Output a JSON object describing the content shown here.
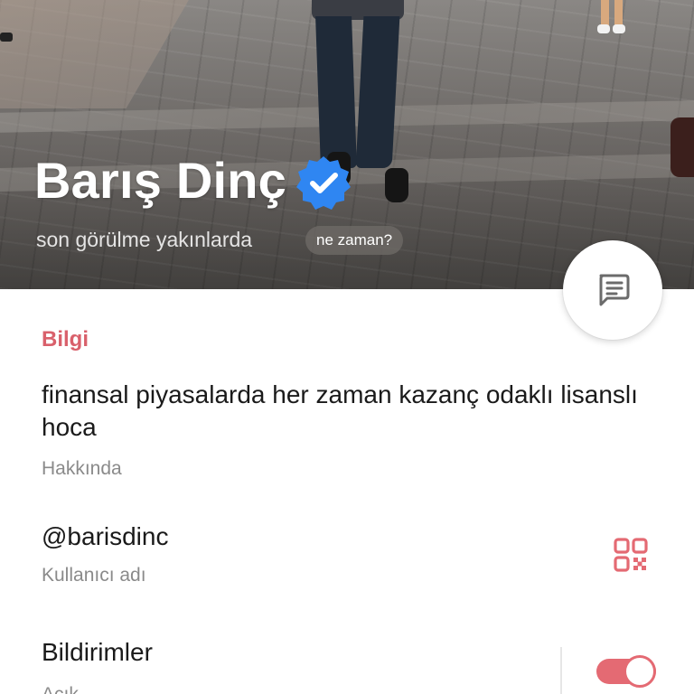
{
  "profile": {
    "name": "Barış Dinç",
    "verified": true,
    "last_seen": "son görülme yakınlarda",
    "when_chip": "ne zaman?"
  },
  "info": {
    "section_title": "Bilgi",
    "about": {
      "value": "finansal piyasalarda her zaman kazanç odaklı lisanslı hoca",
      "label": "Hakkında"
    },
    "username": {
      "value": "@barisdinc",
      "label": "Kullanıcı adı"
    },
    "notifications": {
      "title": "Bildirimler",
      "subtitle": "Açık",
      "enabled": true
    }
  },
  "icons": {
    "message": "message-icon",
    "qr": "qr-code-icon",
    "verified": "verified-badge-icon"
  },
  "colors": {
    "accent": "#d9606b",
    "toggle_on": "#e46a73",
    "verified_blue": "#2f86f2"
  }
}
